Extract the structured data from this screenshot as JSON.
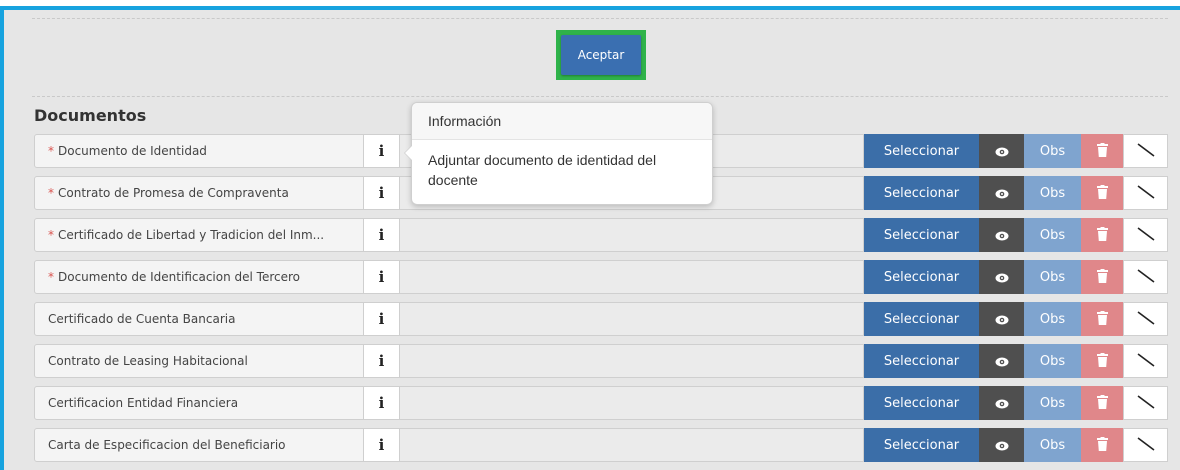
{
  "accept_label": "Aceptar",
  "section_title": "Documentos",
  "actions": {
    "select_label": "Seleccionar",
    "obs_label": "Obs",
    "view_icon": "eye-icon",
    "delete_icon": "trash-icon",
    "clear_icon": "slash-icon"
  },
  "tooltip": {
    "title": "Información",
    "text": "Adjuntar documento de identidad del docente"
  },
  "documents": [
    {
      "label": "Documento de Identidad",
      "required": true
    },
    {
      "label": "Contrato de Promesa de Compraventa",
      "required": true
    },
    {
      "label": "Certificado de Libertad y Tradicion del Inm...",
      "required": true
    },
    {
      "label": "Documento de Identificacion del Tercero",
      "required": true
    },
    {
      "label": "Certificado de Cuenta Bancaria",
      "required": false
    },
    {
      "label": "Contrato de Leasing Habitacional",
      "required": false
    },
    {
      "label": "Certificacion Entidad Financiera",
      "required": false
    },
    {
      "label": "Carta de Especificacion del Beneficiario",
      "required": false
    }
  ],
  "colors": {
    "frame_border": "#17a3df",
    "accept_highlight": "#2fb34a",
    "select_button": "#3b6ea8",
    "view_button": "#4f4f4f",
    "obs_button": "#7fa4cf",
    "delete_button": "#e0878a"
  }
}
